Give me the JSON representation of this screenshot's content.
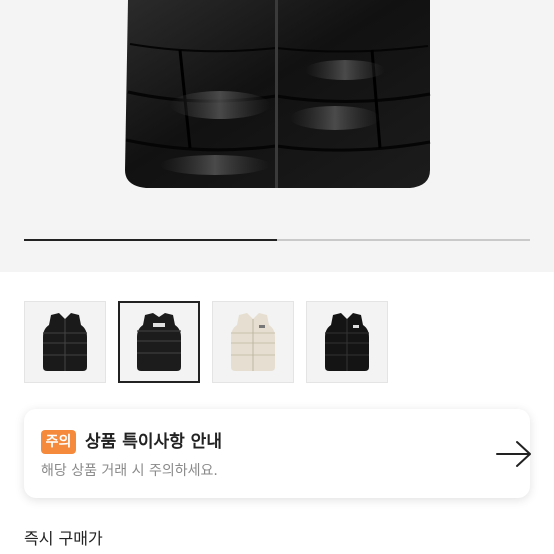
{
  "gallery": {
    "progress": 0.5,
    "thumbnails": [
      {
        "icon": "black-puffer-vest-icon",
        "selected": false
      },
      {
        "icon": "black-puffer-vest-back-icon",
        "selected": true
      },
      {
        "icon": "ivory-puffer-vest-icon",
        "selected": false
      },
      {
        "icon": "black-puffer-vest-matte-icon",
        "selected": false
      }
    ]
  },
  "notice": {
    "badge": "주의",
    "title": "상품 특이사항 안내",
    "subtitle": "해당 상품 거래 시 주의하세요.",
    "badge_color": "#f58a3c",
    "arrow_icon": "arrow-right-icon"
  },
  "price_section": {
    "label": "즉시 구매가"
  }
}
